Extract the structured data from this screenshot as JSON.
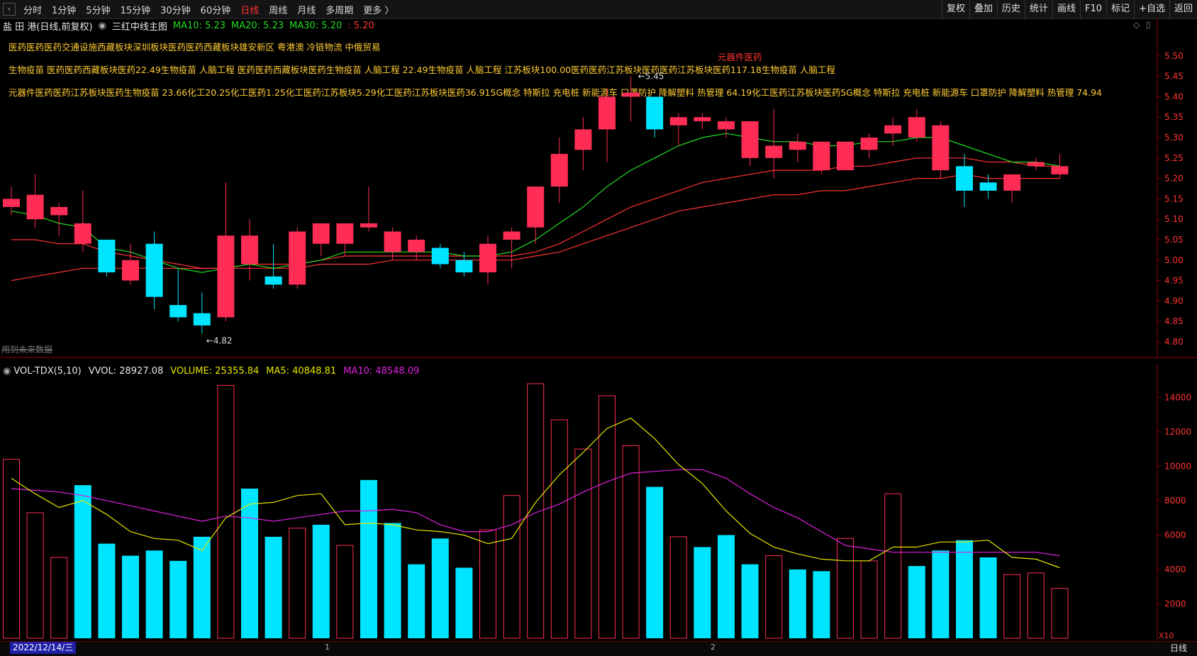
{
  "toolbar": {
    "periods": [
      "分时",
      "1分钟",
      "5分钟",
      "15分钟",
      "30分钟",
      "60分钟",
      "日线",
      "周线",
      "月线",
      "多周期",
      "更多 〉"
    ],
    "active_period": "日线",
    "right_items": [
      "复权",
      "叠加",
      "历史",
      "统计",
      "画线",
      "F10",
      "标记",
      "+自选",
      "返回"
    ]
  },
  "header": {
    "stock": "盐 田 港(日线,前复权)",
    "indicator": "三红中线主图",
    "ma10": "MA10: 5.23",
    "ma20": "MA20: 5.23",
    "ma30": "MA30: 5.20",
    "extra": ": 5.20"
  },
  "annotations": {
    "line1": "医药医药医药交通设施西藏板块深圳板块医药医药西藏板块雄安新区 粤港澳 冷链物流 中俄贸易",
    "line2": "生物疫苗 医药医药西藏板块医药22.49生物疫苗 人脑工程 医药医药西藏板块医药生物疫苗 人脑工程 22.49生物疫苗 人脑工程 江苏板块100.00医药医药江苏板块医药医药江苏板块医药117.18生物疫苗 人脑工程",
    "line3": "元器件医药医药江苏板块医药生物疫苗 23.66化工20.25化工医药1.25化工医药江苏板块5.29化工医药江苏板块医药36.915G概念 特斯拉 充电桩 新能源车 口罩防护 降解塑料 热管理 64.19化工医药江苏板块医药5G概念 特斯拉 充电桩 新能源车 口罩防护 降解塑料 热管理 74.94",
    "red_label": "元器件医药",
    "high_label": "5.45",
    "low_label": "4.82",
    "future_note": "用到未来数据"
  },
  "volume_panel": {
    "title": "VOL-TDX(5,10)",
    "vvol": "VVOL: 28927.08",
    "volume": "VOLUME: 25355.84",
    "ma5": "MA5: 40848.81",
    "ma10": "MA10: 48548.09",
    "unit": "X10"
  },
  "bottom": {
    "date": "2022/12/14/三",
    "marks": [
      "1",
      "2"
    ],
    "right_button": "日线"
  },
  "colors": {
    "up": "#ff2d55",
    "down": "#00e5ff",
    "ma_green": "#22dd22",
    "ma_red": "#ff3333",
    "vol_ma5": "#e6e600",
    "vol_ma10": "#e020e0"
  },
  "chart_data": [
    {
      "type": "candlestick",
      "title": "",
      "ylim": [
        4.76,
        5.55
      ],
      "y_ticks": [
        "5.50",
        "5.45",
        "5.40",
        "5.35",
        "5.30",
        "5.25",
        "5.20",
        "5.15",
        "5.10",
        "5.05",
        "5.00",
        "4.95",
        "4.90",
        "4.85",
        "4.80"
      ],
      "candles": [
        {
          "o": 5.13,
          "c": 5.15,
          "h": 5.18,
          "l": 5.11
        },
        {
          "o": 5.1,
          "c": 5.16,
          "h": 5.21,
          "l": 5.08
        },
        {
          "o": 5.11,
          "c": 5.13,
          "h": 5.14,
          "l": 5.06
        },
        {
          "o": 5.04,
          "c": 5.09,
          "h": 5.17,
          "l": 5.02
        },
        {
          "o": 5.05,
          "c": 4.97,
          "h": 5.05,
          "l": 4.96
        },
        {
          "o": 4.95,
          "c": 5.0,
          "h": 5.04,
          "l": 4.94
        },
        {
          "o": 5.04,
          "c": 4.91,
          "h": 5.07,
          "l": 4.88
        },
        {
          "o": 4.89,
          "c": 4.86,
          "h": 4.98,
          "l": 4.85
        },
        {
          "o": 4.87,
          "c": 4.84,
          "h": 4.92,
          "l": 4.82
        },
        {
          "o": 4.86,
          "c": 5.06,
          "h": 5.19,
          "l": 4.85
        },
        {
          "o": 4.99,
          "c": 5.06,
          "h": 5.1,
          "l": 4.95
        },
        {
          "o": 4.96,
          "c": 4.94,
          "h": 5.04,
          "l": 4.93
        },
        {
          "o": 4.94,
          "c": 5.07,
          "h": 5.08,
          "l": 4.93
        },
        {
          "o": 5.04,
          "c": 5.09,
          "h": 5.09,
          "l": 5.01
        },
        {
          "o": 5.04,
          "c": 5.09,
          "h": 5.09,
          "l": 5.01
        },
        {
          "o": 5.08,
          "c": 5.09,
          "h": 5.18,
          "l": 5.07
        },
        {
          "o": 5.02,
          "c": 5.07,
          "h": 5.08,
          "l": 5.0
        },
        {
          "o": 5.02,
          "c": 5.05,
          "h": 5.06,
          "l": 5.0
        },
        {
          "o": 5.03,
          "c": 4.99,
          "h": 5.04,
          "l": 4.98
        },
        {
          "o": 5.0,
          "c": 4.97,
          "h": 5.02,
          "l": 4.96
        },
        {
          "o": 4.97,
          "c": 5.04,
          "h": 5.06,
          "l": 4.94
        },
        {
          "o": 5.05,
          "c": 5.07,
          "h": 5.08,
          "l": 4.98
        },
        {
          "o": 5.08,
          "c": 5.18,
          "h": 5.18,
          "l": 5.04
        },
        {
          "o": 5.18,
          "c": 5.26,
          "h": 5.3,
          "l": 5.14
        },
        {
          "o": 5.27,
          "c": 5.32,
          "h": 5.35,
          "l": 5.22
        },
        {
          "o": 5.32,
          "c": 5.4,
          "h": 5.42,
          "l": 5.24
        },
        {
          "o": 5.4,
          "c": 5.41,
          "h": 5.45,
          "l": 5.34
        },
        {
          "o": 5.4,
          "c": 5.32,
          "h": 5.4,
          "l": 5.3
        },
        {
          "o": 5.33,
          "c": 5.35,
          "h": 5.36,
          "l": 5.28
        },
        {
          "o": 5.34,
          "c": 5.35,
          "h": 5.36,
          "l": 5.32
        },
        {
          "o": 5.32,
          "c": 5.34,
          "h": 5.35,
          "l": 5.3
        },
        {
          "o": 5.25,
          "c": 5.34,
          "h": 5.34,
          "l": 5.23
        },
        {
          "o": 5.25,
          "c": 5.28,
          "h": 5.37,
          "l": 5.2
        },
        {
          "o": 5.27,
          "c": 5.29,
          "h": 5.31,
          "l": 5.24
        },
        {
          "o": 5.22,
          "c": 5.29,
          "h": 5.29,
          "l": 5.21
        },
        {
          "o": 5.22,
          "c": 5.29,
          "h": 5.29,
          "l": 5.22
        },
        {
          "o": 5.27,
          "c": 5.3,
          "h": 5.31,
          "l": 5.25
        },
        {
          "o": 5.31,
          "c": 5.33,
          "h": 5.35,
          "l": 5.28
        },
        {
          "o": 5.3,
          "c": 5.35,
          "h": 5.37,
          "l": 5.29
        },
        {
          "o": 5.22,
          "c": 5.33,
          "h": 5.34,
          "l": 5.2
        },
        {
          "o": 5.23,
          "c": 5.17,
          "h": 5.26,
          "l": 5.13
        },
        {
          "o": 5.19,
          "c": 5.17,
          "h": 5.21,
          "l": 5.15
        },
        {
          "o": 5.17,
          "c": 5.21,
          "h": 5.21,
          "l": 5.14
        },
        {
          "o": 5.23,
          "c": 5.24,
          "h": 5.25,
          "l": 5.22
        },
        {
          "o": 5.21,
          "c": 5.23,
          "h": 5.26,
          "l": 5.2
        }
      ],
      "ma_green": [
        5.12,
        5.11,
        5.09,
        5.08,
        5.03,
        5.02,
        5.0,
        4.98,
        4.97,
        4.98,
        4.99,
        4.98,
        4.99,
        5.0,
        5.02,
        5.02,
        5.02,
        5.02,
        5.02,
        5.01,
        5.01,
        5.02,
        5.05,
        5.09,
        5.13,
        5.18,
        5.22,
        5.25,
        5.28,
        5.3,
        5.31,
        5.3,
        5.29,
        5.29,
        5.28,
        5.28,
        5.29,
        5.29,
        5.3,
        5.3,
        5.28,
        5.26,
        5.24,
        5.24,
        5.23
      ],
      "ma_red_1": [
        5.05,
        5.05,
        5.04,
        5.04,
        5.02,
        5.01,
        5.0,
        4.99,
        4.98,
        4.98,
        4.99,
        4.99,
        4.99,
        5.0,
        5.01,
        5.01,
        5.01,
        5.01,
        5.01,
        5.01,
        5.01,
        5.01,
        5.02,
        5.04,
        5.07,
        5.1,
        5.13,
        5.15,
        5.17,
        5.19,
        5.2,
        5.21,
        5.22,
        5.22,
        5.22,
        5.23,
        5.23,
        5.24,
        5.25,
        5.25,
        5.25,
        5.24,
        5.24,
        5.23,
        5.23
      ],
      "ma_red_2": [
        4.95,
        4.96,
        4.97,
        4.98,
        4.98,
        4.98,
        4.98,
        4.98,
        4.98,
        4.98,
        4.98,
        4.98,
        4.98,
        4.99,
        4.99,
        4.99,
        5.0,
        5.0,
        5.0,
        5.0,
        5.0,
        5.0,
        5.01,
        5.02,
        5.04,
        5.06,
        5.08,
        5.1,
        5.12,
        5.13,
        5.14,
        5.15,
        5.16,
        5.16,
        5.17,
        5.17,
        5.18,
        5.19,
        5.2,
        5.2,
        5.21,
        5.2,
        5.2,
        5.2,
        5.2
      ]
    },
    {
      "type": "bar",
      "title": "",
      "ylim": [
        0,
        15500
      ],
      "y_ticks": [
        "14000",
        "12000",
        "10000",
        "8000",
        "6000",
        "4000",
        "2000"
      ],
      "values": [
        10400,
        7300,
        4700,
        8900,
        5500,
        4800,
        5100,
        4500,
        5900,
        14700,
        8700,
        5900,
        6400,
        6600,
        5400,
        9200,
        6700,
        4300,
        5800,
        4100,
        6300,
        8300,
        14800,
        12700,
        11000,
        14100,
        11200,
        8800,
        5900,
        5300,
        6000,
        4300,
        4800,
        4000,
        3900,
        5800,
        4500,
        8400,
        4200,
        5100,
        5700,
        4700,
        3700,
        3800,
        2900
      ],
      "up": [
        true,
        true,
        true,
        false,
        false,
        false,
        false,
        false,
        false,
        true,
        false,
        false,
        true,
        false,
        true,
        false,
        false,
        false,
        false,
        false,
        true,
        true,
        true,
        true,
        true,
        true,
        true,
        false,
        true,
        false,
        false,
        false,
        true,
        false,
        false,
        true,
        true,
        true,
        false,
        false,
        false,
        false,
        true,
        true,
        true
      ],
      "ma5": [
        9300,
        8400,
        7600,
        8000,
        7200,
        6200,
        5800,
        5700,
        5100,
        7000,
        7800,
        7900,
        8300,
        8400,
        6600,
        6700,
        6600,
        6300,
        6200,
        6000,
        5500,
        5800,
        7900,
        9500,
        10800,
        12200,
        12800,
        11600,
        10100,
        9000,
        7400,
        6100,
        5300,
        4900,
        4600,
        4500,
        4500,
        5300,
        5300,
        5600,
        5600,
        5700,
        4700,
        4600,
        4100
      ],
      "ma10": [
        8700,
        8600,
        8500,
        8300,
        8000,
        7700,
        7400,
        7100,
        6800,
        7100,
        7000,
        6800,
        7000,
        7200,
        7400,
        7400,
        7500,
        7300,
        6600,
        6200,
        6200,
        6600,
        7300,
        7800,
        8500,
        9100,
        9600,
        9700,
        9800,
        9800,
        9300,
        8400,
        7600,
        7000,
        6200,
        5400,
        5200,
        5000,
        5000,
        5000,
        5000,
        5000,
        5000,
        5000,
        4800
      ]
    }
  ]
}
